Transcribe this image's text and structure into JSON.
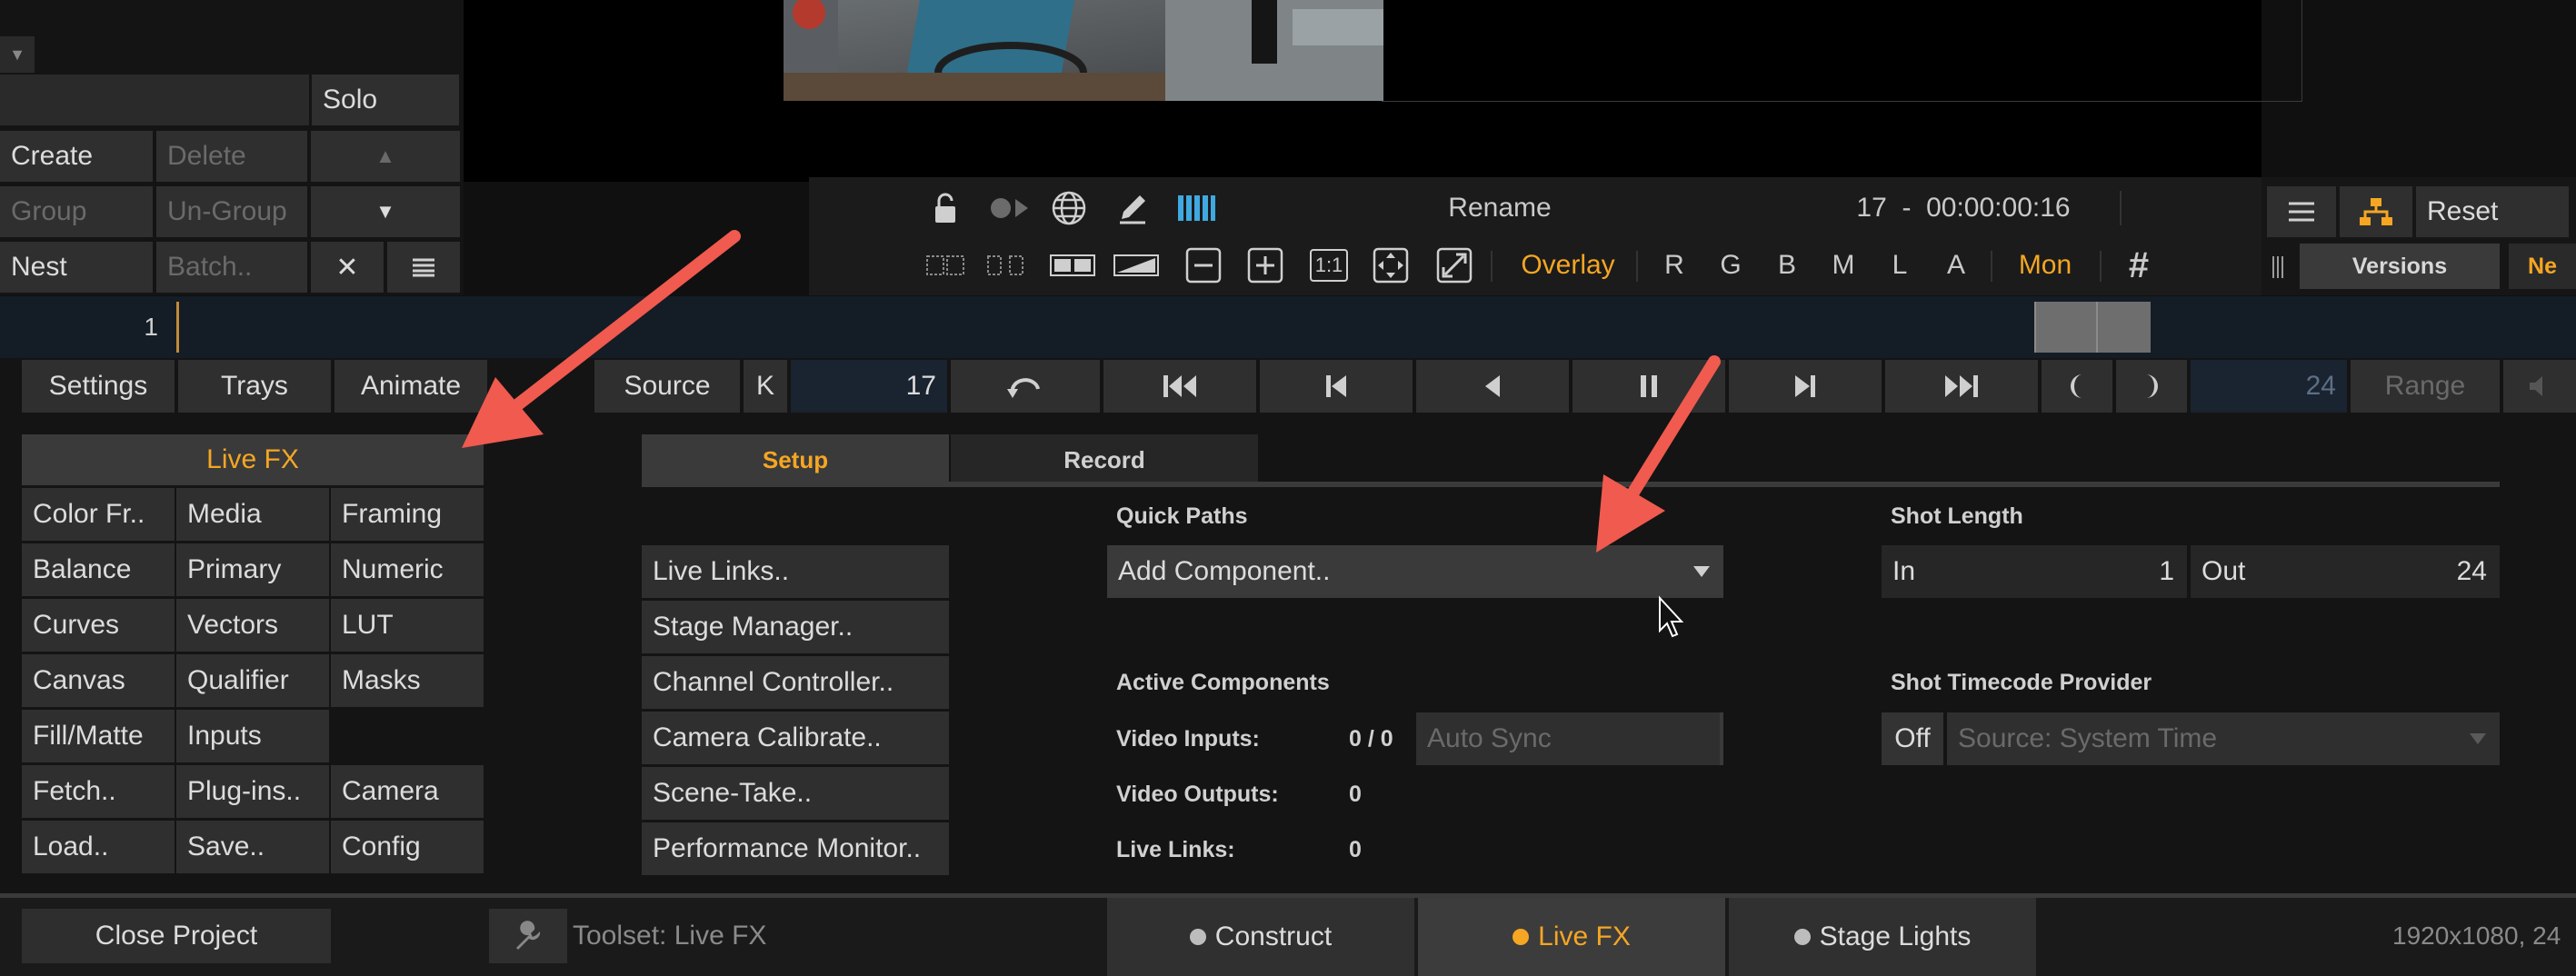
{
  "layers_panel": {
    "collapse_arrow": "▼",
    "solo": "Solo",
    "create": "Create",
    "delete": "Delete",
    "up_arrow": "▲",
    "group": "Group",
    "ungroup": "Un-Group",
    "down_arrow": "▼",
    "nest": "Nest",
    "batch": "Batch..",
    "close_x": "✕"
  },
  "viewer_toolbar": {
    "rename": "Rename",
    "frame_timecode": "17  -  00:00:00:16",
    "one_to_one": "1:1",
    "overlay": "Overlay",
    "channels": [
      "R",
      "G",
      "B",
      "M",
      "L",
      "A"
    ],
    "mon": "Mon",
    "grid_glyph": "#"
  },
  "right_panel": {
    "reset": "Reset",
    "versions": "Versions",
    "next_tab": "Ne"
  },
  "timeline": {
    "layer_number": "1"
  },
  "transport": {
    "settings": "Settings",
    "trays": "Trays",
    "animate": "Animate",
    "source": "Source",
    "k": "K",
    "frame": "17",
    "end_frame": "24",
    "range": "Range"
  },
  "toolset_menu": {
    "title": "Live FX",
    "items": [
      [
        "Color Fr..",
        "Media",
        "Framing"
      ],
      [
        "Balance",
        "Primary",
        "Numeric"
      ],
      [
        "Curves",
        "Vectors",
        "LUT"
      ],
      [
        "Canvas",
        "Qualifier",
        "Masks"
      ],
      [
        "Fill/Matte",
        "Inputs",
        ""
      ],
      [
        "Fetch..",
        "Plug-ins..",
        "Camera"
      ],
      [
        "Load..",
        "Save..",
        "Config"
      ]
    ]
  },
  "livefx_panel": {
    "tabs": [
      "Setup",
      "Record"
    ],
    "links": [
      "Live Links..",
      "Stage Manager..",
      "Channel Controller..",
      "Camera Calibrate..",
      "Scene-Take..",
      "Performance Monitor.."
    ],
    "quick_paths_label": "Quick Paths",
    "quick_paths_value": "Add Component..",
    "active_components_label": "Active Components",
    "video_inputs_label": "Video Inputs:",
    "video_inputs_value": "0 / 0",
    "auto_sync": "Auto Sync",
    "video_outputs_label": "Video Outputs:",
    "video_outputs_value": "0",
    "live_links_label": "Live Links:",
    "live_links_value": "0",
    "shot_length_label": "Shot Length",
    "in_label": "In",
    "in_value": "1",
    "out_label": "Out",
    "out_value": "24",
    "timecode_provider_label": "Shot Timecode Provider",
    "tc_off": "Off",
    "tc_source": "Source: System Time"
  },
  "bottom_bar": {
    "close_project": "Close Project",
    "toolset": "Toolset: Live FX",
    "tabs": [
      {
        "label": "Construct",
        "dot_color": "#bdbdbd"
      },
      {
        "label": "Live FX",
        "dot_color": "#f5a623"
      },
      {
        "label": "Stage Lights",
        "dot_color": "#bdbdbd"
      }
    ],
    "resolution": "1920x1080, 24"
  },
  "colors": {
    "accent": "#f5a623",
    "annotation_arrow": "#f05a4f"
  }
}
